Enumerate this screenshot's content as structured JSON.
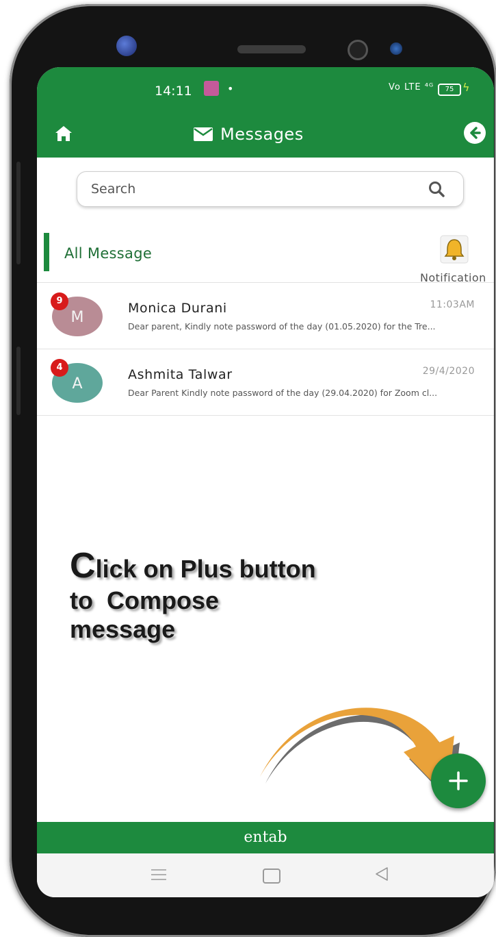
{
  "status_bar": {
    "time": "14:11",
    "dot": "•",
    "network": "Vo LTE ⁴ᴳ",
    "battery": "75"
  },
  "header": {
    "title": "Messages"
  },
  "search": {
    "placeholder": "Search"
  },
  "section": {
    "title": "All Message",
    "notification_label": "Notification"
  },
  "messages": [
    {
      "initial": "M",
      "badge": "9",
      "name": "Monica Durani",
      "time": "11:03AM",
      "preview": "Dear parent, Kindly note password of the day (01.05.2020) for the Tre...",
      "avatar_color": "#b98c95"
    },
    {
      "initial": "A",
      "badge": "4",
      "name": "Ashmita Talwar",
      "time": "29/4/2020",
      "preview": "Dear Parent Kindly note password of the day (29.04.2020) for Zoom cl...",
      "avatar_color": "#5fa79b"
    }
  ],
  "instruction": {
    "cap": "C",
    "line1": "lick on Plus button",
    "line2": "to  Compose",
    "line3": "message"
  },
  "footer": {
    "brand": "entab"
  },
  "colors": {
    "primary": "#1d8a3e",
    "badge": "#d81b1b",
    "arrow": "#e9a23a"
  },
  "icons": [
    "home-icon",
    "envelope-icon",
    "back-arrow-icon",
    "search-icon",
    "bell-icon",
    "plus-icon",
    "nav-menu-icon",
    "nav-home-icon",
    "nav-back-icon"
  ]
}
